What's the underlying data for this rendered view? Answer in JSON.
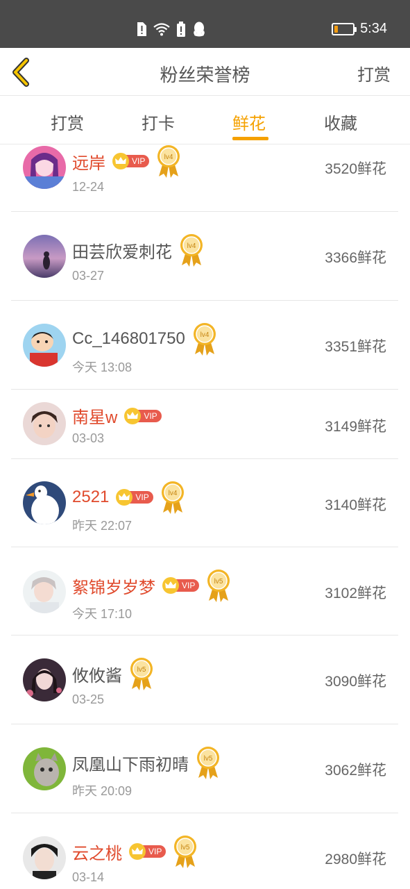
{
  "status_bar": {
    "time": "5:34",
    "battery_level_fraction": 0.2,
    "icons": [
      "alert-icon",
      "wifi-icon",
      "battery-saver-icon",
      "qq-icon"
    ]
  },
  "header": {
    "title": "粉丝荣誉榜",
    "action_label": "打赏",
    "back_icon": "chevron-left-icon",
    "back_color": "#f5c400"
  },
  "tabs": [
    {
      "label": "打赏",
      "active": false
    },
    {
      "label": "打卡",
      "active": false
    },
    {
      "label": "鲜花",
      "active": true
    },
    {
      "label": "收藏",
      "active": false
    }
  ],
  "accent_color": "#f5a100",
  "vip_label": "VIP",
  "users": [
    {
      "name": "远岸",
      "vip": true,
      "level": "lv4",
      "date": "12-24",
      "score": "3520鲜花"
    },
    {
      "name": "田芸欣爱刺花",
      "vip": false,
      "level": "lv4",
      "date": "03-27",
      "score": "3366鲜花"
    },
    {
      "name": "Cc_146801750",
      "vip": false,
      "level": "lv4",
      "date": "今天 13:08",
      "score": "3351鲜花"
    },
    {
      "name": "南星w",
      "vip": true,
      "level": "",
      "date": "03-03",
      "score": "3149鲜花"
    },
    {
      "name": "2521",
      "vip": true,
      "level": "lv4",
      "date": "昨天 22:07",
      "score": "3140鲜花"
    },
    {
      "name": "絮锦岁岁梦",
      "vip": true,
      "level": "lv5",
      "date": "今天 17:10",
      "score": "3102鲜花"
    },
    {
      "name": "攸攸酱",
      "vip": false,
      "level": "lv5",
      "date": "03-25",
      "score": "3090鲜花"
    },
    {
      "name": "凤凰山下雨初晴",
      "vip": false,
      "level": "lv5",
      "date": "昨天 20:09",
      "score": "3062鲜花"
    },
    {
      "name": "云之桃",
      "vip": true,
      "level": "lv5",
      "date": "03-14",
      "score": "2980鲜花"
    }
  ]
}
